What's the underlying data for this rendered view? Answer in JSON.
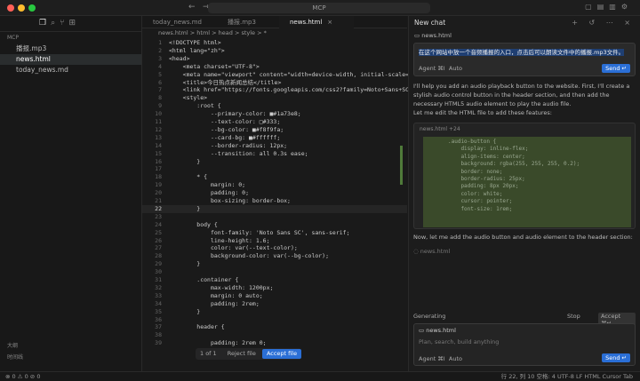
{
  "window": {
    "title": "MCP"
  },
  "left": {
    "explorer_header": "MCP",
    "files": [
      "播报.mp3",
      "news.html",
      "today_news.md"
    ],
    "outline_labels": [
      "大纲",
      "时间线"
    ]
  },
  "tabs": [
    {
      "label": "today_news.md"
    },
    {
      "label": "播报.mp3"
    },
    {
      "label": "news.html"
    }
  ],
  "breadcrumb": "news.html > html > head > style > *",
  "code_lines": [
    {
      "n": "1",
      "t": "<!DOCTYPE html>"
    },
    {
      "n": "2",
      "t": "<html lang=\"zh\">"
    },
    {
      "n": "3",
      "t": "<head>"
    },
    {
      "n": "4",
      "t": "    <meta charset=\"UTF-8\">"
    },
    {
      "n": "5",
      "t": "    <meta name=\"viewport\" content=\"width=device-width, initial-scale=1."
    },
    {
      "n": "6",
      "t": "    <title>今日热点新闻总结</title>"
    },
    {
      "n": "7",
      "t": "    <link href=\"https://fonts.googleapis.com/css2?family=Noto+Sans+SC:w"
    },
    {
      "n": "8",
      "t": "    <style>"
    },
    {
      "n": "9",
      "t": "        :root {"
    },
    {
      "n": "10",
      "t": "            --primary-color: ■#1a73e8;"
    },
    {
      "n": "11",
      "t": "            --text-color: □#333;"
    },
    {
      "n": "12",
      "t": "            --bg-color: ■#f8f9fa;"
    },
    {
      "n": "13",
      "t": "            --card-bg: ■#ffffff;"
    },
    {
      "n": "14",
      "t": "            --border-radius: 12px;"
    },
    {
      "n": "15",
      "t": "            --transition: all 0.3s ease;"
    },
    {
      "n": "16",
      "t": "        }"
    },
    {
      "n": "17",
      "t": ""
    },
    {
      "n": "18",
      "t": "        * {"
    },
    {
      "n": "19",
      "t": "            margin: 0;"
    },
    {
      "n": "20",
      "t": "            padding: 0;"
    },
    {
      "n": "21",
      "t": "            box-sizing: border-box;"
    },
    {
      "n": "22",
      "t": "        }"
    },
    {
      "n": "23",
      "t": ""
    },
    {
      "n": "24",
      "t": "        body {"
    },
    {
      "n": "25",
      "t": "            font-family: 'Noto Sans SC', sans-serif;"
    },
    {
      "n": "26",
      "t": "            line-height: 1.6;"
    },
    {
      "n": "27",
      "t": "            color: var(--text-color);"
    },
    {
      "n": "28",
      "t": "            background-color: var(--bg-color);"
    },
    {
      "n": "29",
      "t": "        }"
    },
    {
      "n": "30",
      "t": ""
    },
    {
      "n": "31",
      "t": "        .container {"
    },
    {
      "n": "32",
      "t": "            max-width: 1200px;"
    },
    {
      "n": "33",
      "t": "            margin: 0 auto;"
    },
    {
      "n": "34",
      "t": "            padding: 2rem;"
    },
    {
      "n": "35",
      "t": "        }"
    },
    {
      "n": "36",
      "t": ""
    },
    {
      "n": "37",
      "t": "        header {"
    },
    {
      "n": "38",
      "t": ""
    },
    {
      "n": "39",
      "t": "            padding: 2rem 0;"
    }
  ],
  "diff_bar": {
    "count": "1 of 1",
    "reject": "Reject file",
    "accept": "Accept file"
  },
  "chat": {
    "title": "New chat",
    "context_file": "news.html",
    "user_message": "在这个网站中放一个音频播报的入口，点击后可以朗读文件中的播报.mp3文件。",
    "mode": "Agent ⌘I",
    "model": "Auto",
    "send": "Send ↵",
    "response_1": "I'll help you add an audio playback button to the website. First, I'll create a stylish audio control button in the header section, and then add the necessary HTML5 audio element to play the audio file.",
    "response_2": "Let me edit the HTML file to add these features:",
    "code_block_file": "news.html +24",
    "code_block_text": ".audio-button {\n    display: inline-flex;\n    align-items: center;\n    background: rgba(255, 255, 255, 0.2);\n    border: none;\n    border-radius: 25px;\n    padding: 8px 20px;\n    color: white;\n    cursor: pointer;\n    font-size: 1rem;",
    "response_3": "Now, let me add the audio button and audio element to the header section:",
    "pending_file": "news.html",
    "generating": "Generating",
    "stop": "Stop",
    "accept_all": "Accept ⌘↵",
    "input_file": "news.html",
    "input_placeholder": "Plan, search, build anything",
    "input_mode": "Agent ⌘I",
    "input_model": "Auto",
    "input_send": "Send ↵"
  },
  "status": {
    "left": "⊗ 0 ⚠ 0   ⊘ 0",
    "right": "行 22, 列 10   空格: 4   UTF-8   LF   HTML   Cursor Tab"
  }
}
